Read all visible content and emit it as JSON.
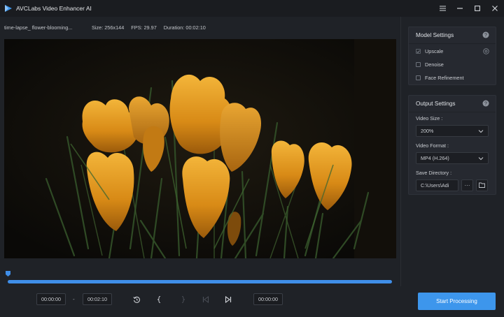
{
  "app": {
    "title": "AVCLabs Video Enhancer AI"
  },
  "info": {
    "filename": "time-lapse_ flower-blooming...",
    "size": "Size:  256x144",
    "fps": "FPS:  29.97",
    "duration": "Duration:  00:02:10"
  },
  "timeline": {
    "progress": 1.0
  },
  "controls": {
    "start_time": "00:00:00",
    "dash": "-",
    "end_time": "00:02:10",
    "current_time": "00:00:00"
  },
  "model_settings": {
    "title": "Model Settings",
    "options": [
      {
        "label": "Upscale",
        "checked": true
      },
      {
        "label": "Denoise",
        "checked": false
      },
      {
        "label": "Face Refinement",
        "checked": false
      }
    ]
  },
  "output_settings": {
    "title": "Output Settings",
    "video_size_label": "Video Size :",
    "video_size_value": "200%",
    "video_format_label": "Video Format :",
    "video_format_value": "MP4 (H.264)",
    "save_dir_label": "Save Directory :",
    "save_dir_value": "C:\\Users\\Adi",
    "browse_label": "···"
  },
  "start_button": {
    "label": "Start Processing"
  },
  "colors": {
    "accent": "#3d96ec",
    "background": "#1f2227",
    "panel": "#262930"
  }
}
